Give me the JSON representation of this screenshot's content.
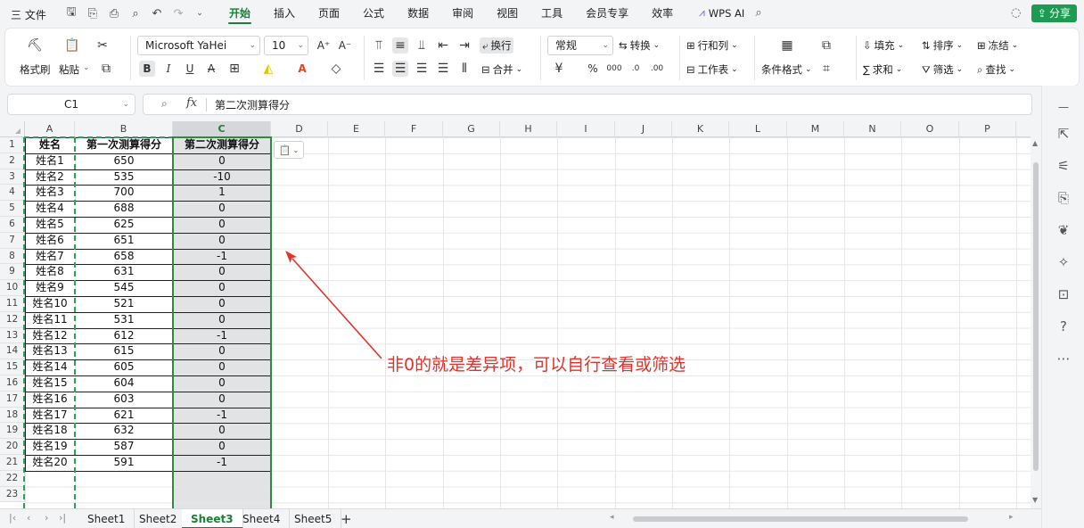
{
  "menubar": {
    "file_label": "三 文件",
    "tabs": [
      "开始",
      "插入",
      "页面",
      "公式",
      "数据",
      "审阅",
      "视图",
      "工具",
      "会员专享",
      "效率"
    ],
    "wps_ai": "WPS AI",
    "share": "分享"
  },
  "ribbon": {
    "format_painter": "格式刷",
    "paste": "粘贴",
    "font_name": "Microsoft YaHei",
    "font_size": "10",
    "wrap": "换行",
    "merge": "合并",
    "number_format": "常规",
    "convert": "转换",
    "rows_cols": "行和列",
    "worksheet": "工作表",
    "cond_format": "条件格式",
    "fill": "填充",
    "sort": "排序",
    "freeze": "冻结",
    "sum": "求和",
    "filter": "筛选",
    "find": "查找"
  },
  "formula_bar": {
    "name_box": "C1",
    "fx": "fx",
    "content": "第二次测算得分"
  },
  "columns": [
    "A",
    "B",
    "C",
    "D",
    "E",
    "F",
    "G",
    "H",
    "I",
    "J",
    "K",
    "L",
    "M",
    "N",
    "O",
    "P"
  ],
  "rows": [
    "1",
    "2",
    "3",
    "4",
    "5",
    "6",
    "7",
    "8",
    "9",
    "10",
    "11",
    "12",
    "13",
    "14",
    "15",
    "16",
    "17",
    "18",
    "19",
    "20",
    "21",
    "22",
    "23"
  ],
  "table": {
    "headers": [
      "姓名",
      "第一次测算得分",
      "第二次测算得分"
    ],
    "data": [
      [
        "姓名1",
        "650",
        "0"
      ],
      [
        "姓名2",
        "535",
        "-10"
      ],
      [
        "姓名3",
        "700",
        "1"
      ],
      [
        "姓名4",
        "688",
        "0"
      ],
      [
        "姓名5",
        "625",
        "0"
      ],
      [
        "姓名6",
        "651",
        "0"
      ],
      [
        "姓名7",
        "658",
        "-1"
      ],
      [
        "姓名8",
        "631",
        "0"
      ],
      [
        "姓名9",
        "545",
        "0"
      ],
      [
        "姓名10",
        "521",
        "0"
      ],
      [
        "姓名11",
        "531",
        "0"
      ],
      [
        "姓名12",
        "612",
        "-1"
      ],
      [
        "姓名13",
        "615",
        "0"
      ],
      [
        "姓名14",
        "605",
        "0"
      ],
      [
        "姓名15",
        "604",
        "0"
      ],
      [
        "姓名16",
        "603",
        "0"
      ],
      [
        "姓名17",
        "621",
        "-1"
      ],
      [
        "姓名18",
        "632",
        "0"
      ],
      [
        "姓名19",
        "587",
        "0"
      ],
      [
        "姓名20",
        "591",
        "-1"
      ]
    ]
  },
  "annotation": "非0的就是差异项，可以自行查看或筛选",
  "sheets": [
    "Sheet1",
    "Sheet2",
    "Sheet3",
    "Sheet4",
    "Sheet5"
  ],
  "active_sheet": "Sheet3",
  "colors": {
    "accent": "#1a7f37",
    "annotation": "#e3322b",
    "share": "#1e9b52"
  }
}
